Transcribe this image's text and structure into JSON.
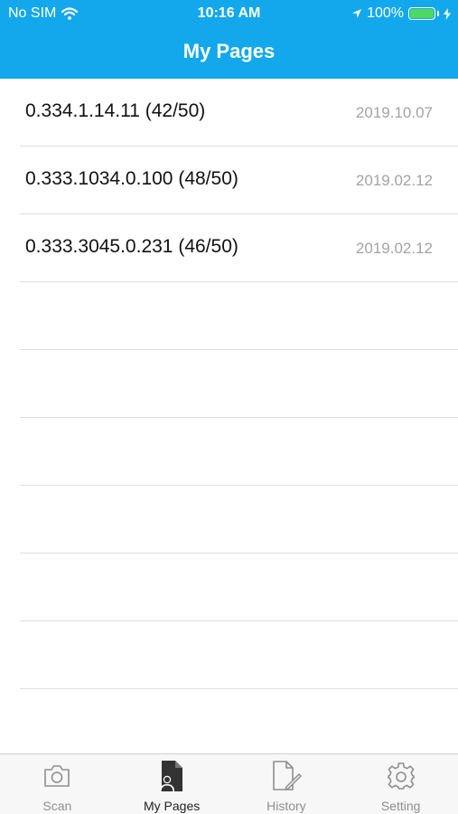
{
  "status_bar": {
    "carrier": "No SIM",
    "time": "10:16 AM",
    "battery": "100%",
    "battery_level": 1.0
  },
  "header": {
    "title": "My Pages",
    "background_color": "#13a8eb"
  },
  "pages": [
    {
      "name": "0.334.1.14.11 (42/50)",
      "date": "2019.10.07"
    },
    {
      "name": "0.333.1034.0.100 (48/50)",
      "date": "2019.02.12"
    },
    {
      "name": "0.333.3045.0.231 (46/50)",
      "date": "2019.02.12"
    },
    {
      "name": "",
      "date": ""
    },
    {
      "name": "",
      "date": ""
    },
    {
      "name": "",
      "date": ""
    },
    {
      "name": "",
      "date": ""
    },
    {
      "name": "",
      "date": ""
    },
    {
      "name": "",
      "date": ""
    },
    {
      "name": "",
      "date": ""
    }
  ],
  "tabbar": {
    "tabs": [
      {
        "label": "Scan",
        "icon": "camera-icon",
        "active": false
      },
      {
        "label": "My Pages",
        "icon": "document-person-icon",
        "active": true
      },
      {
        "label": "History",
        "icon": "document-edit-icon",
        "active": false
      },
      {
        "label": "Setting",
        "icon": "gear-icon",
        "active": false
      }
    ]
  }
}
